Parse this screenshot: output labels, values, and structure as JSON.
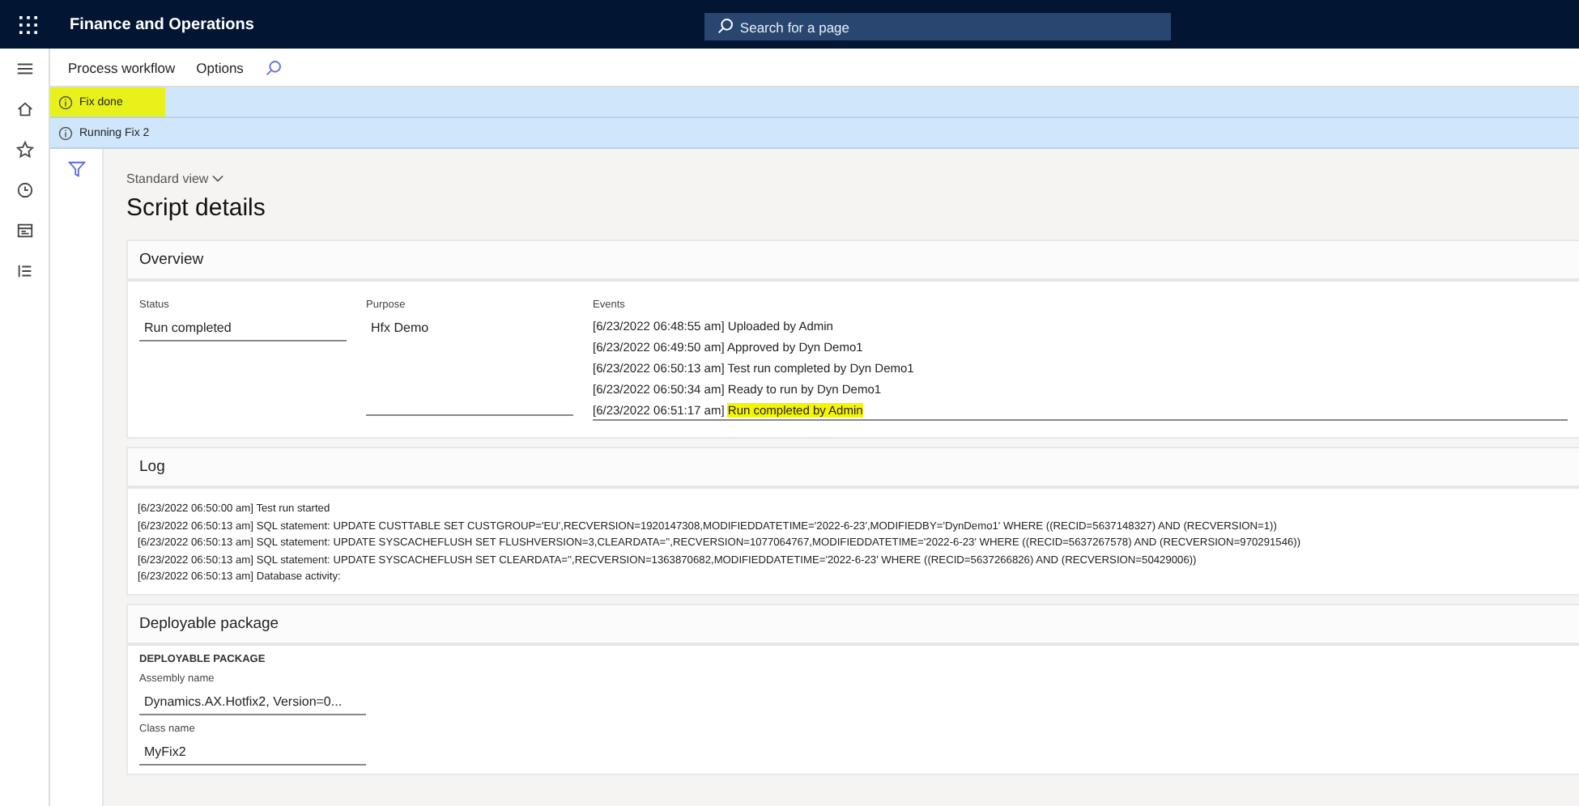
{
  "app_bar": {
    "title": "Finance and Operations",
    "search": {
      "placeholder": "Search for a page"
    }
  },
  "toolbar": {
    "items": [
      "Process workflow",
      "Options"
    ]
  },
  "messages": [
    {
      "text": "Fix done",
      "highlighted": true
    },
    {
      "text": "Running Fix 2",
      "highlighted": false
    }
  ],
  "view": {
    "label": "Standard view"
  },
  "page_title": "Script details",
  "overview": {
    "title": "Overview",
    "status": {
      "label": "Status",
      "value": "Run completed"
    },
    "purpose": {
      "label": "Purpose",
      "value": "Hfx Demo"
    },
    "events": {
      "label": "Events",
      "items": [
        {
          "time": "[6/23/2022 06:48:55 am]",
          "text": "Uploaded by Admin",
          "highlighted": false
        },
        {
          "time": "[6/23/2022 06:49:50 am]",
          "text": "Approved by Dyn Demo1",
          "highlighted": false
        },
        {
          "time": "[6/23/2022 06:50:13 am]",
          "text": "Test run completed by Dyn Demo1",
          "highlighted": false
        },
        {
          "time": "[6/23/2022 06:50:34 am]",
          "text": "Ready to run by Dyn Demo1",
          "highlighted": false
        },
        {
          "time": "[6/23/2022 06:51:17 am]",
          "text": "Run completed by Admin",
          "highlighted": true
        }
      ]
    }
  },
  "log": {
    "title": "Log",
    "lines": [
      "[6/23/2022 06:50:00 am] Test run started",
      "[6/23/2022 06:50:13 am] SQL statement: UPDATE CUSTTABLE SET CUSTGROUP='EU',RECVERSION=1920147308,MODIFIEDDATETIME='2022-6-23',MODIFIEDBY='DynDemo1' WHERE ((RECID=5637148327) AND (RECVERSION=1))",
      "[6/23/2022 06:50:13 am] SQL statement: UPDATE SYSCACHEFLUSH SET FLUSHVERSION=3,CLEARDATA='',RECVERSION=1077064767,MODIFIEDDATETIME='2022-6-23' WHERE ((RECID=5637267578) AND (RECVERSION=970291546))",
      "[6/23/2022 06:50:13 am] SQL statement: UPDATE SYSCACHEFLUSH SET CLEARDATA='',RECVERSION=1363870682,MODIFIEDDATETIME='2022-6-23' WHERE ((RECID=5637266826) AND (RECVERSION=50429006))",
      "[6/23/2022 06:50:13 am] Database activity:"
    ]
  },
  "package": {
    "title": "Deployable package",
    "group": "DEPLOYABLE PACKAGE",
    "assembly": {
      "label": "Assembly name",
      "value": "Dynamics.AX.Hotfix2, Version=0..."
    },
    "class": {
      "label": "Class name",
      "value": "MyFix2"
    }
  }
}
